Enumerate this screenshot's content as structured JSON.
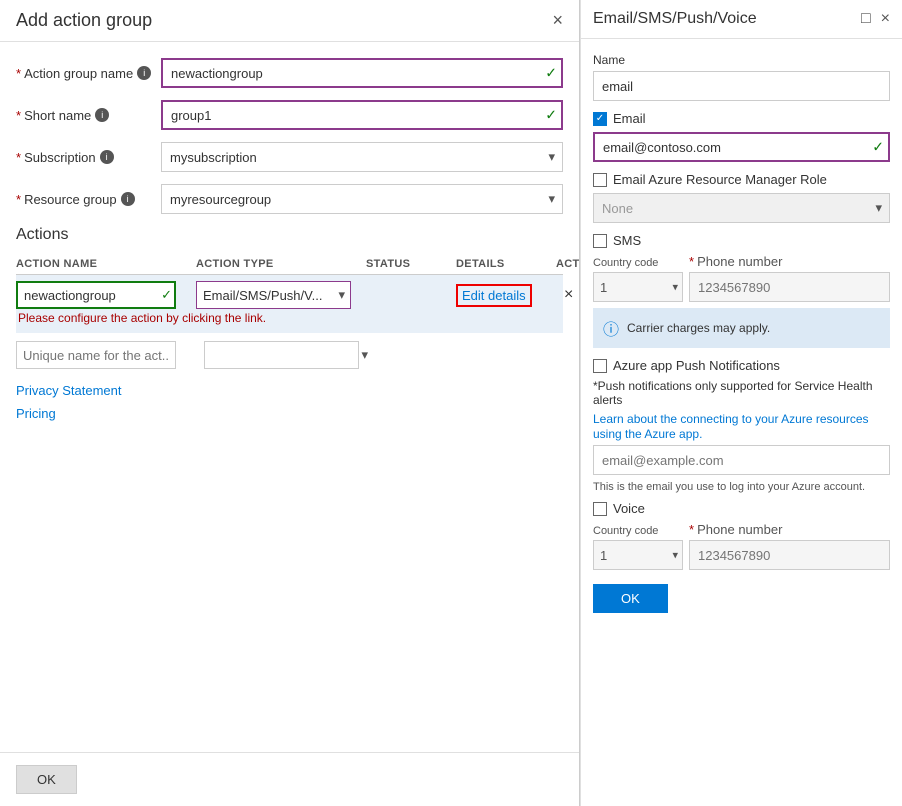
{
  "left_panel": {
    "title": "Add action group",
    "close_icon": "×",
    "fields": {
      "action_group_name": {
        "label": "Action group name",
        "value": "newactiongroup",
        "required": true
      },
      "short_name": {
        "label": "Short name",
        "value": "group1",
        "required": true
      },
      "subscription": {
        "label": "Subscription",
        "value": "mysubscription",
        "required": true
      },
      "resource_group": {
        "label": "Resource group",
        "value": "myresourcegroup",
        "required": true
      }
    },
    "actions_section": {
      "title": "Actions",
      "table_headers": [
        "ACTION NAME",
        "ACTION TYPE",
        "STATUS",
        "DETAILS",
        "ACTIONS"
      ],
      "rows": [
        {
          "name": "newactiongroup",
          "type": "Email/SMS/Push/V...",
          "status": "",
          "details_label": "Edit details",
          "delete_icon": "×",
          "error_msg": "Please configure the action by clicking the link."
        }
      ],
      "add_row": {
        "name_placeholder": "Unique name for the act...",
        "type_placeholder": ""
      }
    },
    "links": {
      "privacy": "Privacy Statement",
      "pricing": "Pricing"
    },
    "footer": {
      "ok_label": "OK"
    }
  },
  "right_panel": {
    "title": "Email/SMS/Push/Voice",
    "maximize_icon": "□",
    "close_icon": "×",
    "name_label": "Name",
    "name_value": "email",
    "email_section": {
      "checkbox_label": "Email",
      "checked": true,
      "email_value": "email@contoso.com"
    },
    "email_azure_role": {
      "checkbox_label": "Email Azure Resource Manager Role",
      "checked": false,
      "select_value": "None"
    },
    "sms_section": {
      "checkbox_label": "SMS",
      "checked": false,
      "country_code_label": "Country code",
      "country_code_value": "1",
      "phone_label": "Phone number",
      "phone_required": true,
      "phone_placeholder": "1234567890"
    },
    "carrier_notice": "Carrier charges may apply.",
    "push_section": {
      "checkbox_label": "Azure app Push Notifications",
      "checked": false,
      "note": "*Push notifications only supported for Service Health alerts",
      "learn_link": "Learn about the connecting to your Azure resources using the Azure app.",
      "email_placeholder": "email@example.com",
      "account_note": "This is the email you use to log into your Azure account."
    },
    "voice_section": {
      "checkbox_label": "Voice",
      "checked": false,
      "country_code_label": "Country code",
      "country_code_value": "1",
      "phone_label": "Phone number",
      "phone_required": true,
      "phone_placeholder": "1234567890"
    },
    "ok_label": "OK"
  }
}
